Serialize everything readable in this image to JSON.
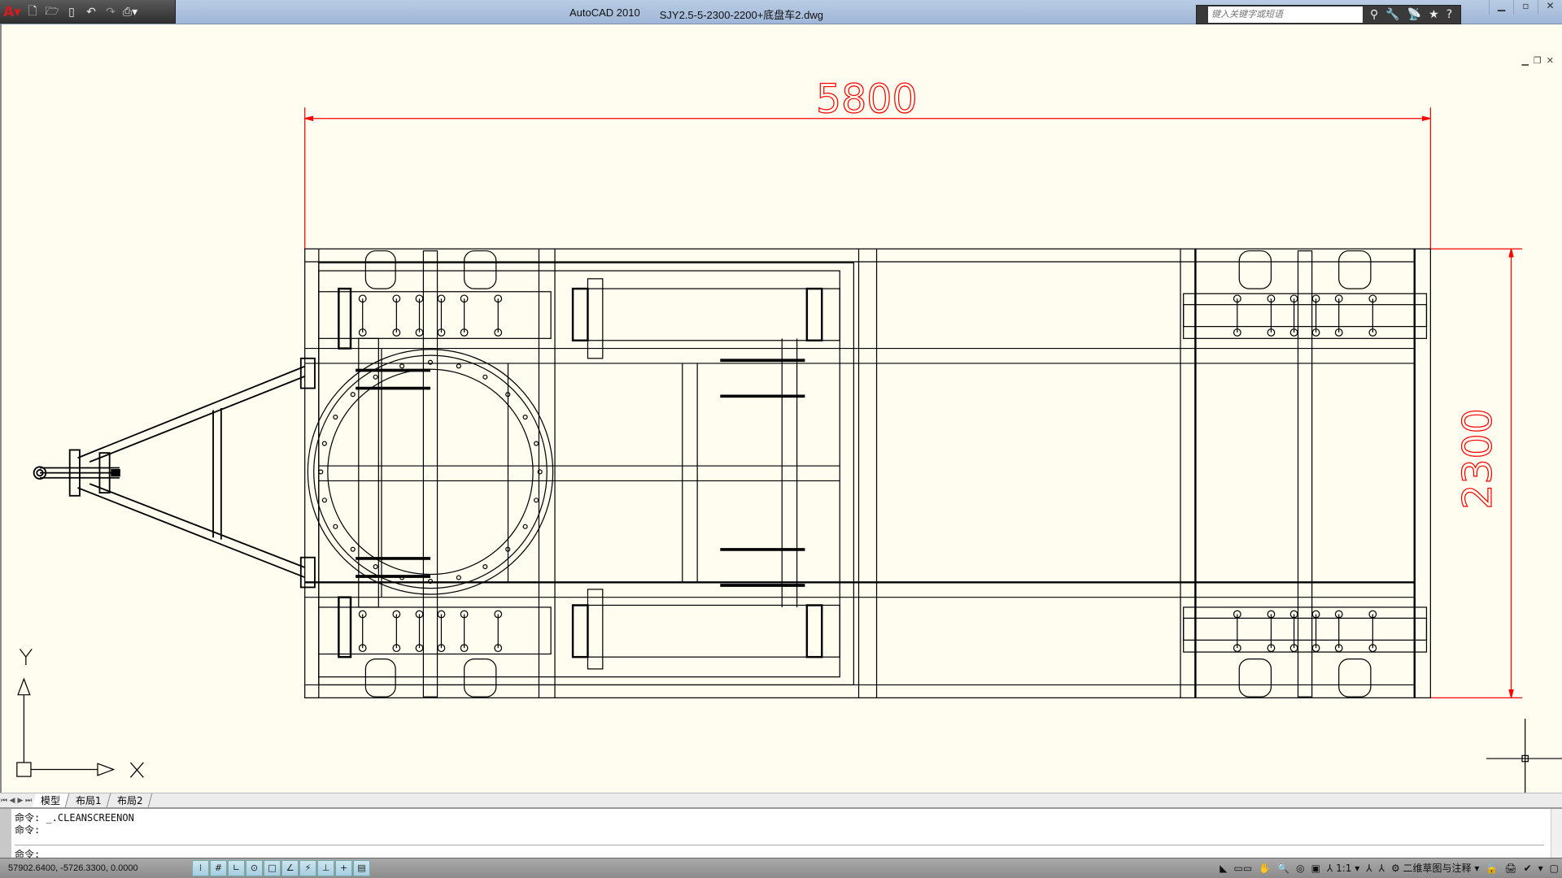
{
  "titlebar": {
    "app": "AutoCAD 2010",
    "file": "SJY2.5-5-2300-2200+底盘车2.dwg",
    "search_placeholder": "键入关键字或短语"
  },
  "quick_access": [
    "new-icon",
    "open-icon",
    "save-icon",
    "undo-icon",
    "redo-icon",
    "plot-icon"
  ],
  "drawing": {
    "dim_length": "5800",
    "dim_width": "2300",
    "ucs_x": "X",
    "ucs_y": "Y",
    "colors": {
      "background": "#fffcf0",
      "dimension": "#ff0000",
      "geometry": "#000000"
    }
  },
  "tabs": [
    {
      "label": "模型",
      "active": true
    },
    {
      "label": "布局1"
    },
    {
      "label": "布局2"
    }
  ],
  "command": {
    "history": [
      "命令:  _.CLEANSCREENON",
      "命令:"
    ],
    "prompt": "命令:"
  },
  "status": {
    "coords": "57902.6400,  -5726.3300,  0.0000",
    "scale": "1:1",
    "workspace": "二维草图与注释"
  }
}
